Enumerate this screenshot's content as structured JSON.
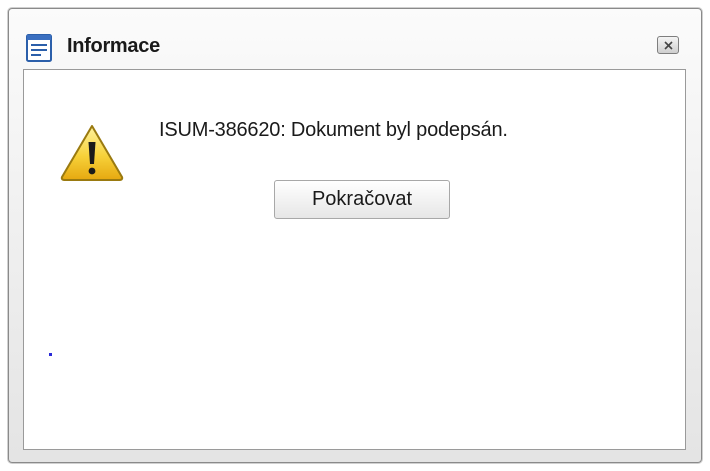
{
  "dialog": {
    "title": "Informace",
    "title_icon": "document-lines-icon",
    "close_icon": "close-icon",
    "message": "ISUM-386620: Dokument byl podepsán.",
    "message_icon": "warning-icon",
    "continue_label": "Pokračovat"
  }
}
